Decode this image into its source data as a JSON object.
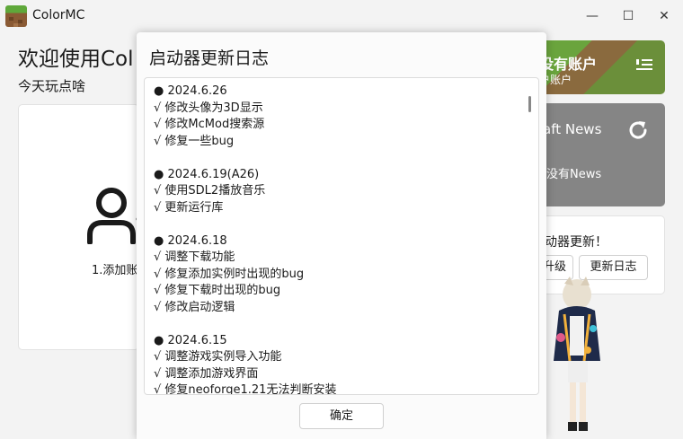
{
  "window": {
    "title": "ColorMC",
    "minimize_glyph": "—",
    "maximize_glyph": "☐",
    "close_glyph": "✕"
  },
  "main": {
    "welcome": "欢迎使用Col",
    "subtitle": "今天玩点啥",
    "add_account_label": "1.添加账"
  },
  "account_card": {
    "title": "没有账户",
    "subtitle": "户账户"
  },
  "news_card": {
    "title": "aft News",
    "empty_text": "没有News"
  },
  "update_card": {
    "title": "动器更新！",
    "upgrade_label": "升级",
    "changelog_label": "更新日志"
  },
  "dialog": {
    "title": "启动器更新日志",
    "ok_label": "确定",
    "entries": [
      {
        "date": "● 2024.6.26",
        "items": [
          "√ 修改头像为3D显示",
          "√ 修改McMod搜索源",
          "√ 修复一些bug"
        ]
      },
      {
        "date": "● 2024.6.19(A26)",
        "items": [
          "√ 使用SDL2播放音乐",
          "√ 更新运行库"
        ]
      },
      {
        "date": "● 2024.6.18",
        "items": [
          "√ 调整下载功能",
          "√ 修复添加实例时出现的bug",
          "√ 修复下载时出现的bug",
          "√ 修改启动逻辑"
        ]
      },
      {
        "date": "● 2024.6.15",
        "items": [
          "√ 调整游戏实例导入功能",
          "√ 调整添加游戏界面",
          "√ 修复neoforge1.21无法判断安装"
        ]
      }
    ]
  }
}
